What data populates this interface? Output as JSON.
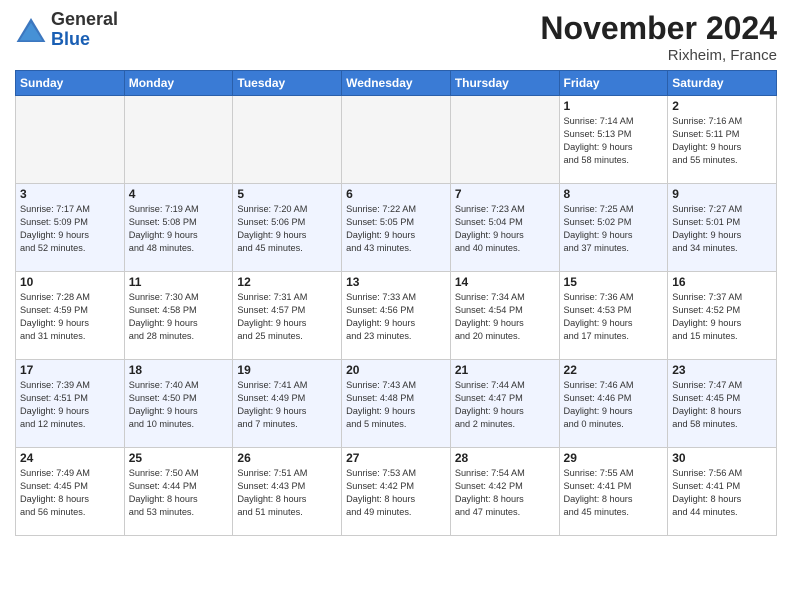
{
  "header": {
    "logo_general": "General",
    "logo_blue": "Blue",
    "month_title": "November 2024",
    "location": "Rixheim, France"
  },
  "weekdays": [
    "Sunday",
    "Monday",
    "Tuesday",
    "Wednesday",
    "Thursday",
    "Friday",
    "Saturday"
  ],
  "weeks": [
    [
      {
        "day": "",
        "info": ""
      },
      {
        "day": "",
        "info": ""
      },
      {
        "day": "",
        "info": ""
      },
      {
        "day": "",
        "info": ""
      },
      {
        "day": "",
        "info": ""
      },
      {
        "day": "1",
        "info": "Sunrise: 7:14 AM\nSunset: 5:13 PM\nDaylight: 9 hours\nand 58 minutes."
      },
      {
        "day": "2",
        "info": "Sunrise: 7:16 AM\nSunset: 5:11 PM\nDaylight: 9 hours\nand 55 minutes."
      }
    ],
    [
      {
        "day": "3",
        "info": "Sunrise: 7:17 AM\nSunset: 5:09 PM\nDaylight: 9 hours\nand 52 minutes."
      },
      {
        "day": "4",
        "info": "Sunrise: 7:19 AM\nSunset: 5:08 PM\nDaylight: 9 hours\nand 48 minutes."
      },
      {
        "day": "5",
        "info": "Sunrise: 7:20 AM\nSunset: 5:06 PM\nDaylight: 9 hours\nand 45 minutes."
      },
      {
        "day": "6",
        "info": "Sunrise: 7:22 AM\nSunset: 5:05 PM\nDaylight: 9 hours\nand 43 minutes."
      },
      {
        "day": "7",
        "info": "Sunrise: 7:23 AM\nSunset: 5:04 PM\nDaylight: 9 hours\nand 40 minutes."
      },
      {
        "day": "8",
        "info": "Sunrise: 7:25 AM\nSunset: 5:02 PM\nDaylight: 9 hours\nand 37 minutes."
      },
      {
        "day": "9",
        "info": "Sunrise: 7:27 AM\nSunset: 5:01 PM\nDaylight: 9 hours\nand 34 minutes."
      }
    ],
    [
      {
        "day": "10",
        "info": "Sunrise: 7:28 AM\nSunset: 4:59 PM\nDaylight: 9 hours\nand 31 minutes."
      },
      {
        "day": "11",
        "info": "Sunrise: 7:30 AM\nSunset: 4:58 PM\nDaylight: 9 hours\nand 28 minutes."
      },
      {
        "day": "12",
        "info": "Sunrise: 7:31 AM\nSunset: 4:57 PM\nDaylight: 9 hours\nand 25 minutes."
      },
      {
        "day": "13",
        "info": "Sunrise: 7:33 AM\nSunset: 4:56 PM\nDaylight: 9 hours\nand 23 minutes."
      },
      {
        "day": "14",
        "info": "Sunrise: 7:34 AM\nSunset: 4:54 PM\nDaylight: 9 hours\nand 20 minutes."
      },
      {
        "day": "15",
        "info": "Sunrise: 7:36 AM\nSunset: 4:53 PM\nDaylight: 9 hours\nand 17 minutes."
      },
      {
        "day": "16",
        "info": "Sunrise: 7:37 AM\nSunset: 4:52 PM\nDaylight: 9 hours\nand 15 minutes."
      }
    ],
    [
      {
        "day": "17",
        "info": "Sunrise: 7:39 AM\nSunset: 4:51 PM\nDaylight: 9 hours\nand 12 minutes."
      },
      {
        "day": "18",
        "info": "Sunrise: 7:40 AM\nSunset: 4:50 PM\nDaylight: 9 hours\nand 10 minutes."
      },
      {
        "day": "19",
        "info": "Sunrise: 7:41 AM\nSunset: 4:49 PM\nDaylight: 9 hours\nand 7 minutes."
      },
      {
        "day": "20",
        "info": "Sunrise: 7:43 AM\nSunset: 4:48 PM\nDaylight: 9 hours\nand 5 minutes."
      },
      {
        "day": "21",
        "info": "Sunrise: 7:44 AM\nSunset: 4:47 PM\nDaylight: 9 hours\nand 2 minutes."
      },
      {
        "day": "22",
        "info": "Sunrise: 7:46 AM\nSunset: 4:46 PM\nDaylight: 9 hours\nand 0 minutes."
      },
      {
        "day": "23",
        "info": "Sunrise: 7:47 AM\nSunset: 4:45 PM\nDaylight: 8 hours\nand 58 minutes."
      }
    ],
    [
      {
        "day": "24",
        "info": "Sunrise: 7:49 AM\nSunset: 4:45 PM\nDaylight: 8 hours\nand 56 minutes."
      },
      {
        "day": "25",
        "info": "Sunrise: 7:50 AM\nSunset: 4:44 PM\nDaylight: 8 hours\nand 53 minutes."
      },
      {
        "day": "26",
        "info": "Sunrise: 7:51 AM\nSunset: 4:43 PM\nDaylight: 8 hours\nand 51 minutes."
      },
      {
        "day": "27",
        "info": "Sunrise: 7:53 AM\nSunset: 4:42 PM\nDaylight: 8 hours\nand 49 minutes."
      },
      {
        "day": "28",
        "info": "Sunrise: 7:54 AM\nSunset: 4:42 PM\nDaylight: 8 hours\nand 47 minutes."
      },
      {
        "day": "29",
        "info": "Sunrise: 7:55 AM\nSunset: 4:41 PM\nDaylight: 8 hours\nand 45 minutes."
      },
      {
        "day": "30",
        "info": "Sunrise: 7:56 AM\nSunset: 4:41 PM\nDaylight: 8 hours\nand 44 minutes."
      }
    ]
  ]
}
